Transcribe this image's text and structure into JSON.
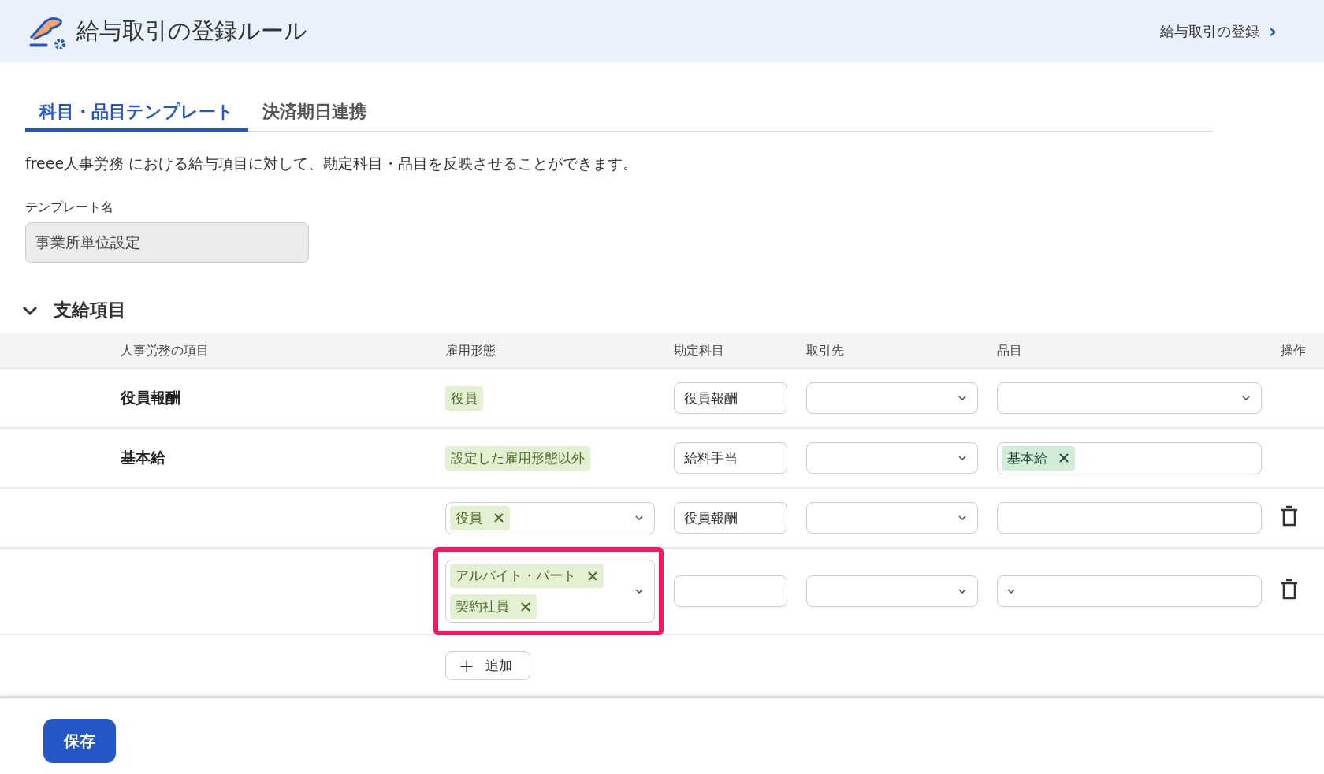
{
  "header": {
    "title": "給与取引の登録ルール",
    "link": "給与取引の登録",
    "link_arrow": "›"
  },
  "tabs": [
    {
      "label": "科目・品目テンプレート",
      "selected": true
    },
    {
      "label": "決済期日連携",
      "selected": false
    }
  ],
  "description": "freee人事労務 における給与項目に対して、勘定科目・品目を反映させることができます。",
  "template": {
    "label": "テンプレート名",
    "value": "事業所単位設定"
  },
  "section": {
    "title": "支給項目",
    "expanded": true
  },
  "table": {
    "columns": [
      "人事労務の項目",
      "雇用形態",
      "勘定科目",
      "取引先",
      "品目",
      "操作"
    ],
    "rows": [
      {
        "item": "役員報酬",
        "employment": {
          "kind": "tags",
          "tags": [
            {
              "label": "役員",
              "removable": false
            }
          ]
        },
        "account": "役員報酬",
        "partner_chevron": true,
        "product": {
          "kind": "select"
        },
        "deletable": false,
        "highlighted": false
      },
      {
        "item": "基本給",
        "employment": {
          "kind": "tags",
          "tags": [
            {
              "label": "設定した雇用形態以外",
              "removable": false
            }
          ]
        },
        "account": "給料手当",
        "partner_chevron": true,
        "product": {
          "kind": "tags",
          "tags": [
            {
              "label": "基本給",
              "removable": true
            }
          ]
        },
        "deletable": false,
        "highlighted": false
      },
      {
        "employment": {
          "kind": "select",
          "tags": [
            {
              "label": "役員",
              "removable": true
            }
          ]
        },
        "account": "役員報酬",
        "partner_chevron": true,
        "product": {
          "kind": "field"
        },
        "deletable": true,
        "highlighted": false
      },
      {
        "employment": {
          "kind": "select",
          "tags": [
            {
              "label": "アルバイト・パート",
              "removable": true
            },
            {
              "label": "契約社員",
              "removable": true
            }
          ]
        },
        "partner_chevron": true,
        "product": {
          "kind": "caret_left"
        },
        "deletable": true,
        "highlighted": true
      }
    ],
    "add_button": {
      "icon": "+",
      "label": "追加"
    }
  },
  "save_button": "保存"
}
